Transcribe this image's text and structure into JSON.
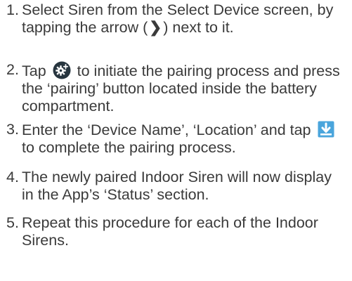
{
  "steps": [
    {
      "number": "1",
      "text_before": "Select Siren from the Select Device screen, by tapping the arrow (",
      "arrow_glyph": "❯",
      "text_after": ") next to it."
    },
    {
      "number": "2",
      "text_before": "Tap",
      "icon": "gear-plus-icon",
      "text_after": "to initiate the pairing process and press the ‘pairing’ button located inside the battery compartment."
    },
    {
      "number": "3",
      "text_before": "Enter the ‘Device Name’, ‘Location’ and tap",
      "icon": "save-download-icon",
      "text_after": "to complete the pairing process."
    },
    {
      "number": "4",
      "text": "The newly paired Indoor Siren will now display in the App’s ‘Status’ section."
    },
    {
      "number": "5",
      "text": "Repeat this procedure for each of the Indoor Sirens."
    }
  ],
  "colors": {
    "text": "#3a3a3a",
    "gear_icon": "#27353f",
    "save_icon_bg": "#4aa5dc",
    "save_icon_arrow": "#ffffff"
  }
}
